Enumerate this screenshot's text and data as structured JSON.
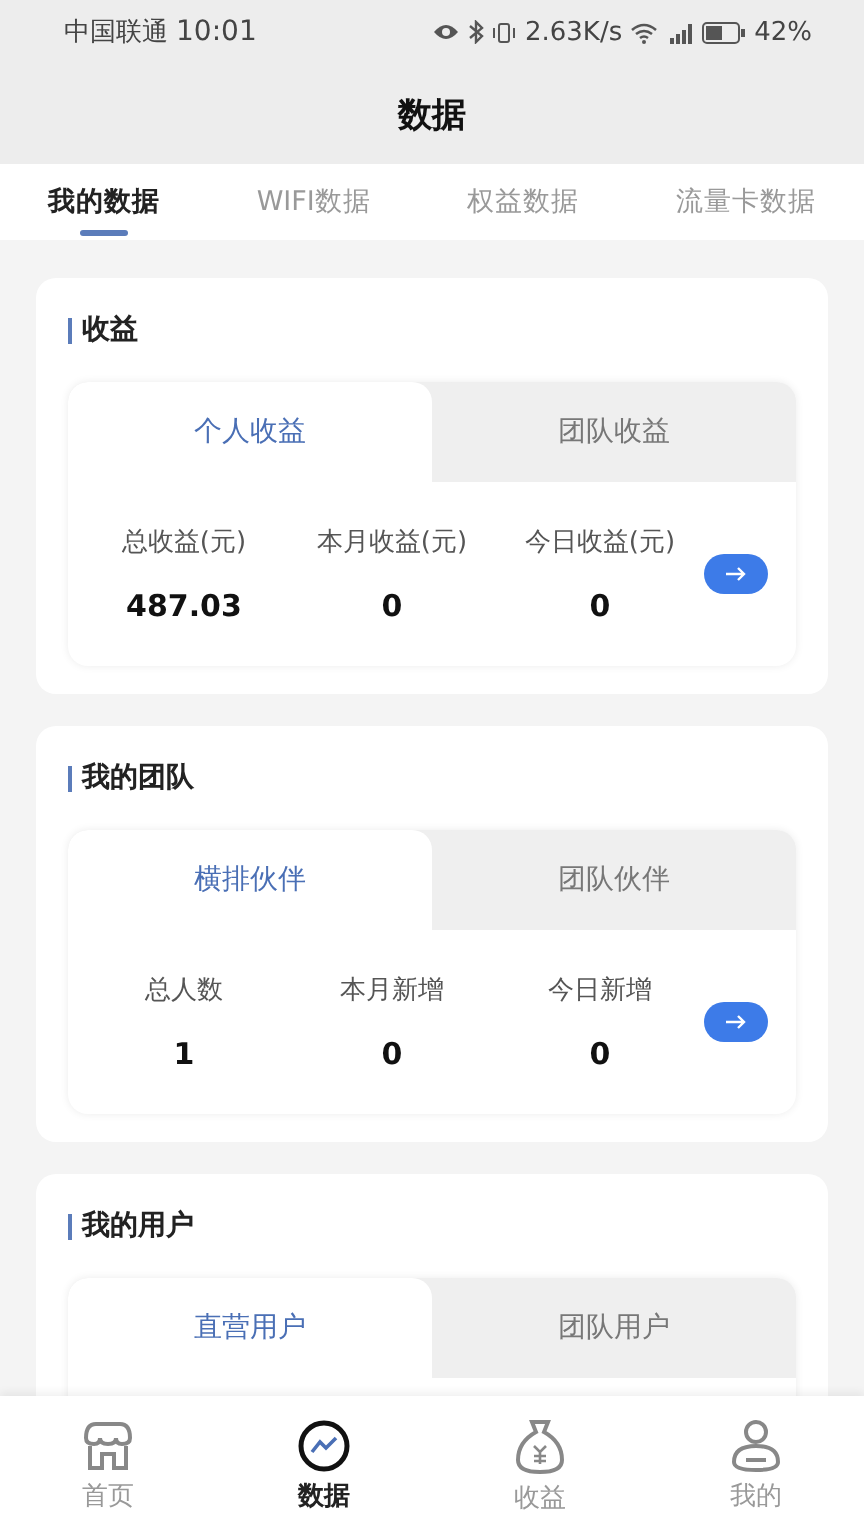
{
  "status_bar": {
    "carrier": "中国联通",
    "time": "10:01",
    "speed": "2.63K/s",
    "battery": "42%"
  },
  "header": {
    "title": "数据"
  },
  "tabs": [
    {
      "label": "我的数据",
      "selected": true
    },
    {
      "label": "WIFI数据",
      "selected": false
    },
    {
      "label": "权益数据",
      "selected": false
    },
    {
      "label": "流量卡数据",
      "selected": false
    }
  ],
  "sections": [
    {
      "title": "收益",
      "tabs": [
        {
          "label": "个人收益",
          "selected": true
        },
        {
          "label": "团队收益",
          "selected": false
        }
      ],
      "stats": [
        {
          "label": "总收益(元)",
          "value": "487.03"
        },
        {
          "label": "本月收益(元)",
          "value": "0"
        },
        {
          "label": "今日收益(元)",
          "value": "0"
        }
      ]
    },
    {
      "title": "我的团队",
      "tabs": [
        {
          "label": "横排伙伴",
          "selected": true
        },
        {
          "label": "团队伙伴",
          "selected": false
        }
      ],
      "stats": [
        {
          "label": "总人数",
          "value": "1"
        },
        {
          "label": "本月新增",
          "value": "0"
        },
        {
          "label": "今日新增",
          "value": "0"
        }
      ]
    },
    {
      "title": "我的用户",
      "tabs": [
        {
          "label": "直营用户",
          "selected": true
        },
        {
          "label": "团队用户",
          "selected": false
        }
      ]
    }
  ],
  "bottom_nav": [
    {
      "kind": "home",
      "label": "首页",
      "selected": false
    },
    {
      "kind": "data",
      "label": "数据",
      "selected": true
    },
    {
      "kind": "income",
      "label": "收益",
      "selected": false
    },
    {
      "kind": "profile",
      "label": "我的",
      "selected": false
    }
  ]
}
